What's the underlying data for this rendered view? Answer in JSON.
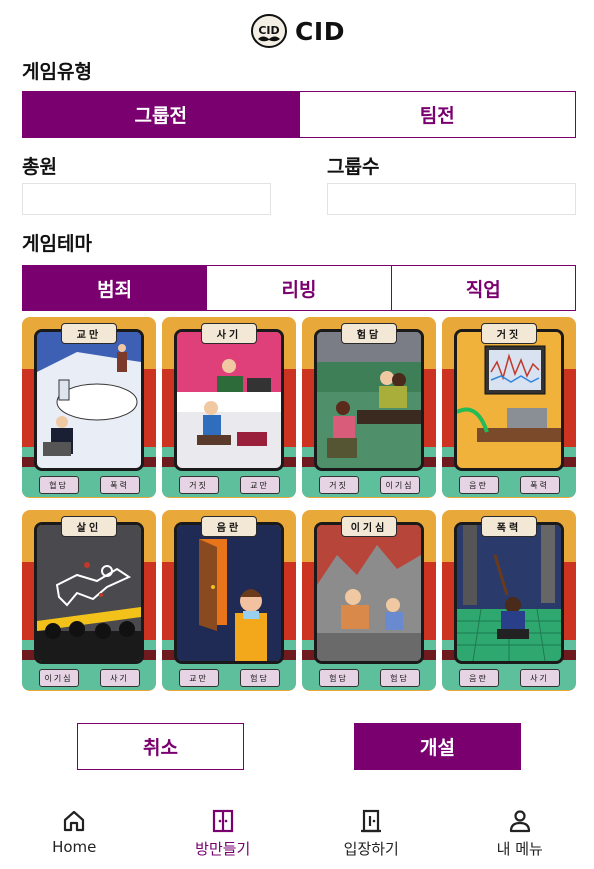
{
  "app": {
    "title": "CID"
  },
  "game_type": {
    "label": "게임유형",
    "options": [
      "그룹전",
      "팀전"
    ],
    "selected": "그룹전"
  },
  "total": {
    "label": "총원",
    "value": ""
  },
  "groups": {
    "label": "그룹수",
    "value": ""
  },
  "theme": {
    "label": "게임테마",
    "options": [
      "범죄",
      "리빙",
      "직업"
    ],
    "selected": "범죄"
  },
  "cards": [
    {
      "title": "교만",
      "tags": [
        "협담",
        "폭력"
      ],
      "scene": "office"
    },
    {
      "title": "사기",
      "tags": [
        "거짓",
        "교만"
      ],
      "scene": "scam"
    },
    {
      "title": "험담",
      "tags": [
        "거짓",
        "이기심"
      ],
      "scene": "gossip"
    },
    {
      "title": "거짓",
      "tags": [
        "음란",
        "폭력"
      ],
      "scene": "monitor"
    },
    {
      "title": "살인",
      "tags": [
        "이기심",
        "사기"
      ],
      "scene": "murder"
    },
    {
      "title": "음란",
      "tags": [
        "교만",
        "험담"
      ],
      "scene": "door"
    },
    {
      "title": "이기심",
      "tags": [
        "험담",
        "험담"
      ],
      "scene": "ruins"
    },
    {
      "title": "폭력",
      "tags": [
        "음란",
        "사기"
      ],
      "scene": "violence"
    }
  ],
  "actions": {
    "cancel": "취소",
    "open": "개설"
  },
  "nav": [
    {
      "label": "Home",
      "icon": "home-icon",
      "active": false
    },
    {
      "label": "방만들기",
      "icon": "door-open-icon",
      "active": true
    },
    {
      "label": "입장하기",
      "icon": "door-enter-icon",
      "active": false
    },
    {
      "label": "내 메뉴",
      "icon": "user-icon",
      "active": false
    }
  ],
  "colors": {
    "accent": "#7a0070",
    "card_orange": "#e8a93a",
    "card_red": "#cc3320",
    "card_teal": "#5dbf9c"
  }
}
